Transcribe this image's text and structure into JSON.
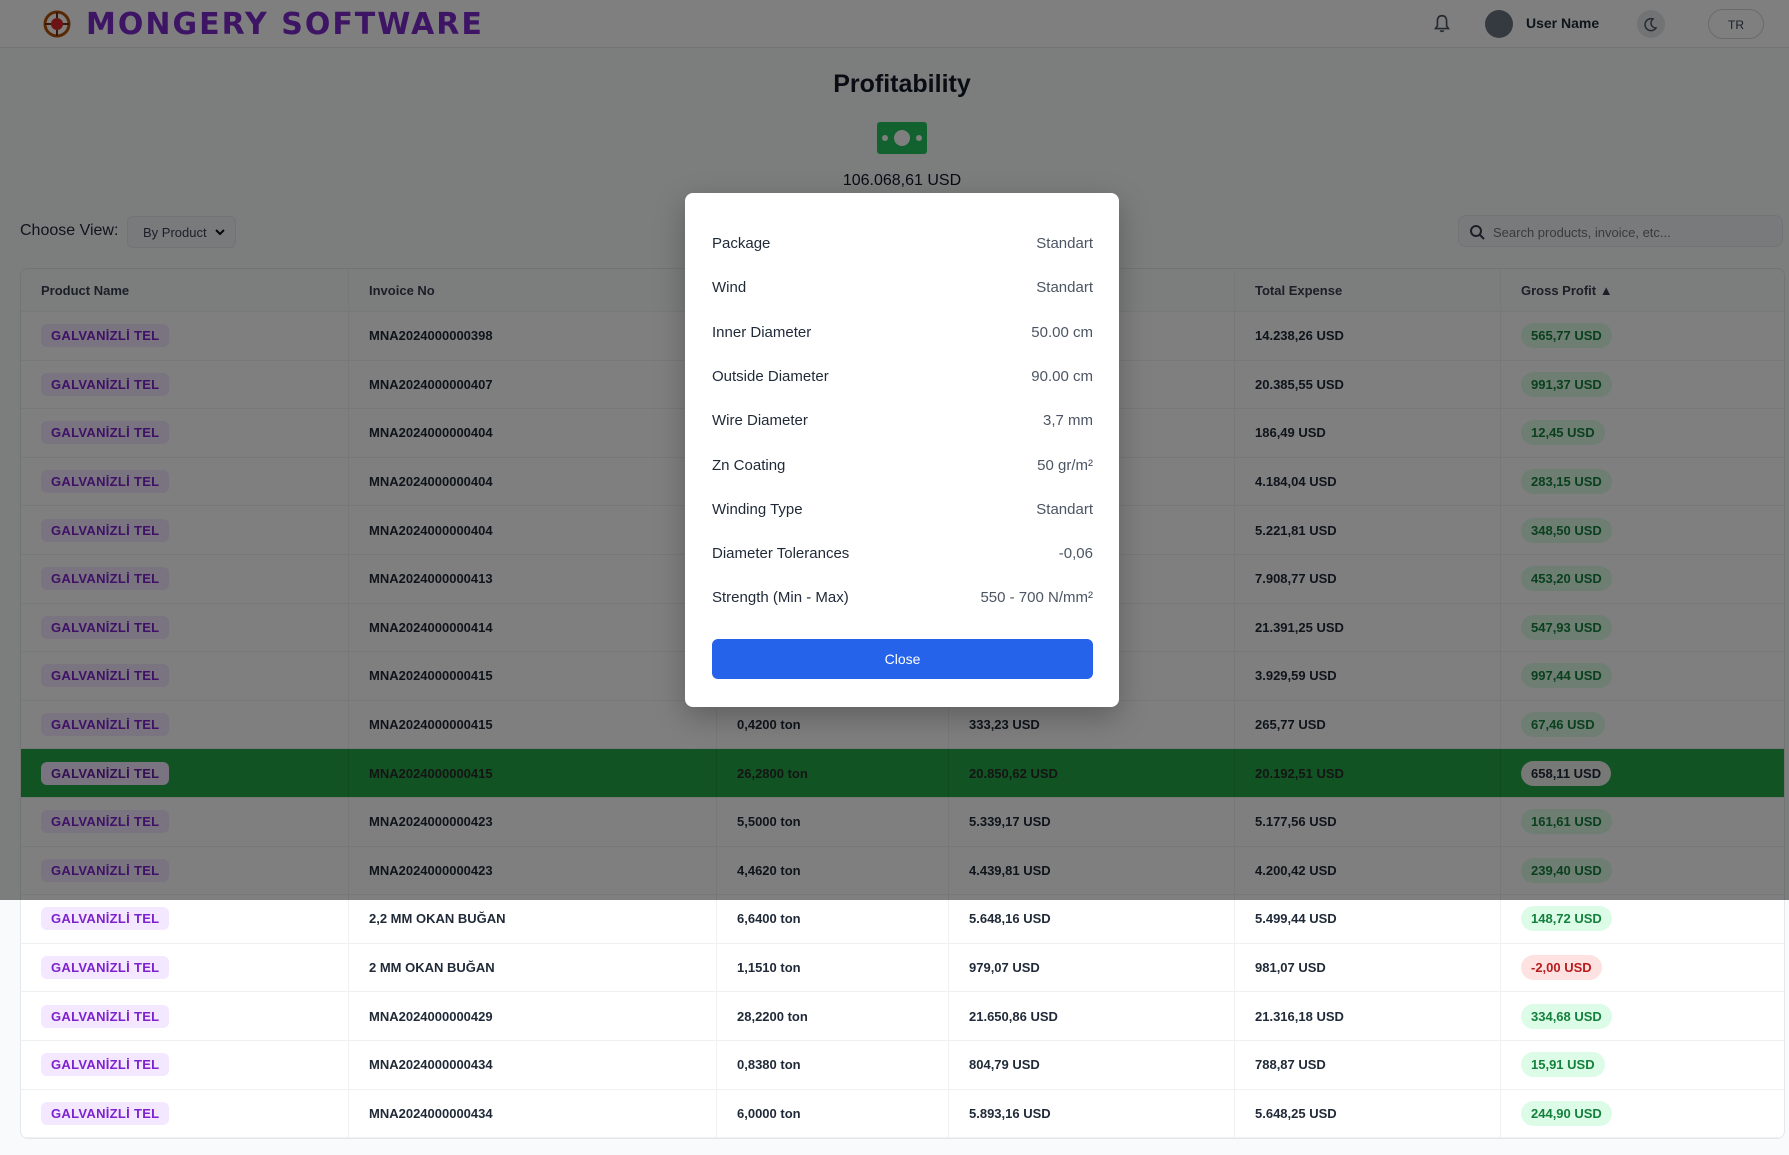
{
  "brand": {
    "name": "MONGERY SOFTWARE"
  },
  "header": {
    "user_name": "User Name",
    "language": "TR"
  },
  "page": {
    "title": "Profitability",
    "total": "106.068,61 USD"
  },
  "controls": {
    "view_label": "Choose View:",
    "view_value": "By Product",
    "search_placeholder": "Search products, invoice, etc..."
  },
  "table": {
    "columns": [
      "Product Name",
      "Invoice No",
      "",
      "",
      "Total Expense",
      "Gross Profit ▲"
    ],
    "rows": [
      {
        "product": "GALVANİZLİ TEL",
        "invoice": "MNA2024000000398",
        "qty": "",
        "sales": "",
        "expense": "14.238,26 USD",
        "profit": "565,77 USD"
      },
      {
        "product": "GALVANİZLİ TEL",
        "invoice": "MNA2024000000407",
        "qty": "",
        "sales": "",
        "expense": "20.385,55 USD",
        "profit": "991,37 USD"
      },
      {
        "product": "GALVANİZLİ TEL",
        "invoice": "MNA2024000000404",
        "qty": "",
        "sales": "",
        "expense": "186,49 USD",
        "profit": "12,45 USD"
      },
      {
        "product": "GALVANİZLİ TEL",
        "invoice": "MNA2024000000404",
        "qty": "",
        "sales": "",
        "expense": "4.184,04 USD",
        "profit": "283,15 USD"
      },
      {
        "product": "GALVANİZLİ TEL",
        "invoice": "MNA2024000000404",
        "qty": "",
        "sales": "",
        "expense": "5.221,81 USD",
        "profit": "348,50 USD"
      },
      {
        "product": "GALVANİZLİ TEL",
        "invoice": "MNA2024000000413",
        "qty": "",
        "sales": "",
        "expense": "7.908,77 USD",
        "profit": "453,20 USD"
      },
      {
        "product": "GALVANİZLİ TEL",
        "invoice": "MNA2024000000414",
        "qty": "",
        "sales": "",
        "expense": "21.391,25 USD",
        "profit": "547,93 USD"
      },
      {
        "product": "GALVANİZLİ TEL",
        "invoice": "MNA2024000000415",
        "qty": "",
        "sales": "",
        "expense": "3.929,59 USD",
        "profit": "997,44 USD"
      },
      {
        "product": "GALVANİZLİ TEL",
        "invoice": "MNA2024000000415",
        "qty": "0,4200 ton",
        "sales": "333,23 USD",
        "expense": "265,77 USD",
        "profit": "67,46 USD"
      },
      {
        "product": "GALVANİZLİ TEL",
        "invoice": "MNA2024000000415",
        "qty": "26,2800 ton",
        "sales": "20.850,62 USD",
        "expense": "20.192,51 USD",
        "profit": "658,11 USD"
      },
      {
        "product": "GALVANİZLİ TEL",
        "invoice": "MNA2024000000423",
        "qty": "5,5000 ton",
        "sales": "5.339,17 USD",
        "expense": "5.177,56 USD",
        "profit": "161,61 USD"
      },
      {
        "product": "GALVANİZLİ TEL",
        "invoice": "MNA2024000000423",
        "qty": "4,4620 ton",
        "sales": "4.439,81 USD",
        "expense": "4.200,42 USD",
        "profit": "239,40 USD"
      },
      {
        "product": "GALVANİZLİ TEL",
        "invoice": "2,2 MM OKAN BUĞAN",
        "qty": "6,6400 ton",
        "sales": "5.648,16 USD",
        "expense": "5.499,44 USD",
        "profit": "148,72 USD"
      },
      {
        "product": "GALVANİZLİ TEL",
        "invoice": "2 MM OKAN BUĞAN",
        "qty": "1,1510 ton",
        "sales": "979,07 USD",
        "expense": "981,07 USD",
        "profit": "-2,00 USD"
      },
      {
        "product": "GALVANİZLİ TEL",
        "invoice": "MNA2024000000429",
        "qty": "28,2200 ton",
        "sales": "21.650,86 USD",
        "expense": "21.316,18 USD",
        "profit": "334,68 USD"
      },
      {
        "product": "GALVANİZLİ TEL",
        "invoice": "MNA2024000000434",
        "qty": "0,8380 ton",
        "sales": "804,79 USD",
        "expense": "788,87 USD",
        "profit": "15,91 USD"
      },
      {
        "product": "GALVANİZLİ TEL",
        "invoice": "MNA2024000000434",
        "qty": "6,0000 ton",
        "sales": "5.893,16 USD",
        "expense": "5.648,25 USD",
        "profit": "244,90 USD"
      }
    ]
  },
  "modal": {
    "specs": [
      {
        "label": "Package",
        "value": "Standart"
      },
      {
        "label": "Wind",
        "value": "Standart"
      },
      {
        "label": "Inner Diameter",
        "value": "50.00 cm"
      },
      {
        "label": "Outside Diameter",
        "value": "90.00 cm"
      },
      {
        "label": "Wire Diameter",
        "value": "3,7 mm"
      },
      {
        "label": "Zn Coating",
        "value": "50 gr/m²"
      },
      {
        "label": "Winding Type",
        "value": "Standart"
      },
      {
        "label": "Diameter Tolerances",
        "value": "-0,06"
      },
      {
        "label": "Strength (Min - Max)",
        "value": "550 - 700 N/mm²"
      }
    ],
    "close_label": "Close"
  },
  "colors": {
    "brand": "#7a2bc9",
    "selected_row": "#22a646",
    "primary_button": "#2563eb",
    "profit_positive": "#15803d",
    "profit_negative": "#b91c1c"
  },
  "icons": {
    "logo": "brand-logo-icon",
    "bell": "bell-icon",
    "avatar": "avatar-icon",
    "theme": "moon-icon",
    "money": "money-bill-icon",
    "search": "search-icon",
    "chevron": "chevron-down-icon"
  }
}
